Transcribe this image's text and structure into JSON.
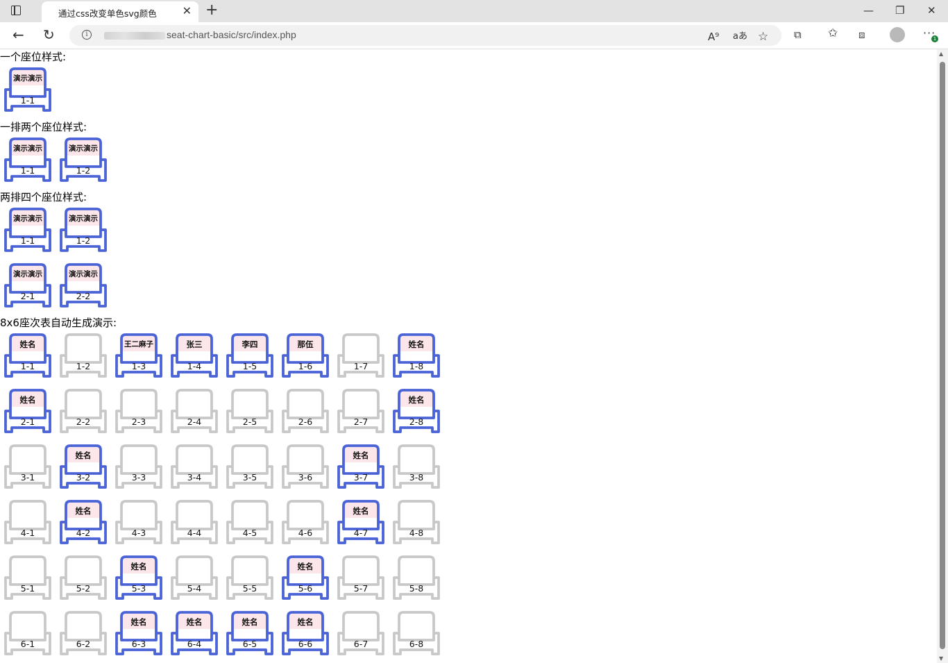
{
  "browser": {
    "tab_title": "通过css改变单色svg颜色",
    "tab_close": "✕",
    "new_tab": "+",
    "minimize": "—",
    "restore": "❐",
    "close": "✕",
    "back": "←",
    "reload": "↻",
    "url": "seat-chart-basic/src/index.php",
    "read_aloud_icon": "A⁹",
    "translate_icon": "aあ",
    "favorite_icon": "☆",
    "extensions_icon": "⧉",
    "favorites_icon": "✩",
    "collections_icon": "⧈",
    "menu": "···",
    "badge": "1"
  },
  "colors": {
    "taken": "#4a63d6",
    "empty": "#c8c8c8",
    "name_bg": "#fde6ea"
  },
  "sections": [
    {
      "title": "一个座位样式:",
      "seats": [
        {
          "name": "演示演示",
          "num": "1-1",
          "taken": true
        }
      ]
    },
    {
      "title": "一排两个座位样式:",
      "seats": [
        {
          "name": "演示演示",
          "num": "1-1",
          "taken": true
        },
        {
          "name": "演示演示",
          "num": "1-2",
          "taken": true
        }
      ]
    },
    {
      "title": "两排四个座位样式:",
      "rows": [
        [
          {
            "name": "演示演示",
            "num": "1-1",
            "taken": true
          },
          {
            "name": "演示演示",
            "num": "1-2",
            "taken": true
          }
        ],
        [
          {
            "name": "演示演示",
            "num": "2-1",
            "taken": true
          },
          {
            "name": "演示演示",
            "num": "2-2",
            "taken": true
          }
        ]
      ]
    },
    {
      "title": "8x6座次表自动生成演示:",
      "rows": [
        [
          {
            "name": "姓名",
            "num": "1-1",
            "taken": true
          },
          {
            "name": "",
            "num": "1-2",
            "taken": false
          },
          {
            "name": "王二麻子",
            "num": "1-3",
            "taken": true
          },
          {
            "name": "张三",
            "num": "1-4",
            "taken": true
          },
          {
            "name": "李四",
            "num": "1-5",
            "taken": true
          },
          {
            "name": "那伍",
            "num": "1-6",
            "taken": true
          },
          {
            "name": "",
            "num": "1-7",
            "taken": false
          },
          {
            "name": "姓名",
            "num": "1-8",
            "taken": true
          }
        ],
        [
          {
            "name": "姓名",
            "num": "2-1",
            "taken": true
          },
          {
            "name": "",
            "num": "2-2",
            "taken": false
          },
          {
            "name": "",
            "num": "2-3",
            "taken": false
          },
          {
            "name": "",
            "num": "2-4",
            "taken": false
          },
          {
            "name": "",
            "num": "2-5",
            "taken": false
          },
          {
            "name": "",
            "num": "2-6",
            "taken": false
          },
          {
            "name": "",
            "num": "2-7",
            "taken": false
          },
          {
            "name": "姓名",
            "num": "2-8",
            "taken": true
          }
        ],
        [
          {
            "name": "",
            "num": "3-1",
            "taken": false
          },
          {
            "name": "姓名",
            "num": "3-2",
            "taken": true
          },
          {
            "name": "",
            "num": "3-3",
            "taken": false
          },
          {
            "name": "",
            "num": "3-4",
            "taken": false
          },
          {
            "name": "",
            "num": "3-5",
            "taken": false
          },
          {
            "name": "",
            "num": "3-6",
            "taken": false
          },
          {
            "name": "姓名",
            "num": "3-7",
            "taken": true
          },
          {
            "name": "",
            "num": "3-8",
            "taken": false
          }
        ],
        [
          {
            "name": "",
            "num": "4-1",
            "taken": false
          },
          {
            "name": "姓名",
            "num": "4-2",
            "taken": true
          },
          {
            "name": "",
            "num": "4-3",
            "taken": false
          },
          {
            "name": "",
            "num": "4-4",
            "taken": false
          },
          {
            "name": "",
            "num": "4-5",
            "taken": false
          },
          {
            "name": "",
            "num": "4-6",
            "taken": false
          },
          {
            "name": "姓名",
            "num": "4-7",
            "taken": true
          },
          {
            "name": "",
            "num": "4-8",
            "taken": false
          }
        ],
        [
          {
            "name": "",
            "num": "5-1",
            "taken": false
          },
          {
            "name": "",
            "num": "5-2",
            "taken": false
          },
          {
            "name": "姓名",
            "num": "5-3",
            "taken": true
          },
          {
            "name": "",
            "num": "5-4",
            "taken": false
          },
          {
            "name": "",
            "num": "5-5",
            "taken": false
          },
          {
            "name": "姓名",
            "num": "5-6",
            "taken": true
          },
          {
            "name": "",
            "num": "5-7",
            "taken": false
          },
          {
            "name": "",
            "num": "5-8",
            "taken": false
          }
        ],
        [
          {
            "name": "",
            "num": "6-1",
            "taken": false
          },
          {
            "name": "",
            "num": "6-2",
            "taken": false
          },
          {
            "name": "姓名",
            "num": "6-3",
            "taken": true
          },
          {
            "name": "姓名",
            "num": "6-4",
            "taken": true
          },
          {
            "name": "姓名",
            "num": "6-5",
            "taken": true
          },
          {
            "name": "姓名",
            "num": "6-6",
            "taken": true
          },
          {
            "name": "",
            "num": "6-7",
            "taken": false
          },
          {
            "name": "",
            "num": "6-8",
            "taken": false
          }
        ]
      ]
    }
  ]
}
